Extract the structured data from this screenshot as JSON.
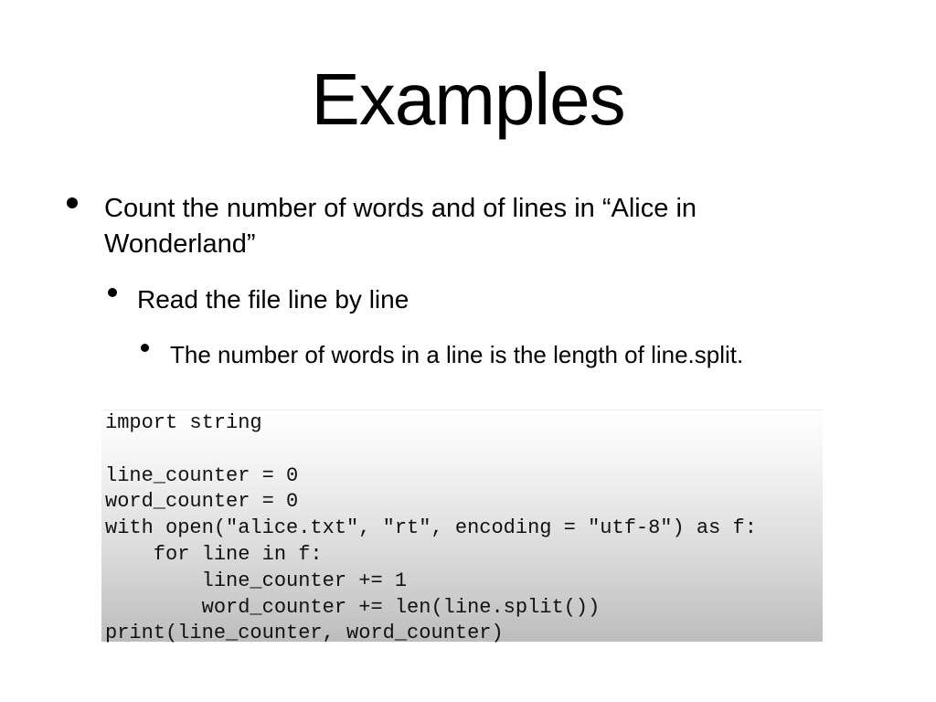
{
  "slide": {
    "title": "Examples",
    "bullets": [
      {
        "level": 1,
        "text": "Count the number of words and of lines in “Alice in Wonderland”"
      },
      {
        "level": 2,
        "text": "Read the file line by line"
      },
      {
        "level": 3,
        "text": "The number of words in a line is the length of line.split."
      }
    ],
    "code": "import string\n\nline_counter = 0\nword_counter = 0\nwith open(\"alice.txt\", \"rt\", encoding = \"utf-8\") as f:\n    for line in f:\n        line_counter += 1\n        word_counter += len(line.split())\nprint(line_counter, word_counter)"
  }
}
